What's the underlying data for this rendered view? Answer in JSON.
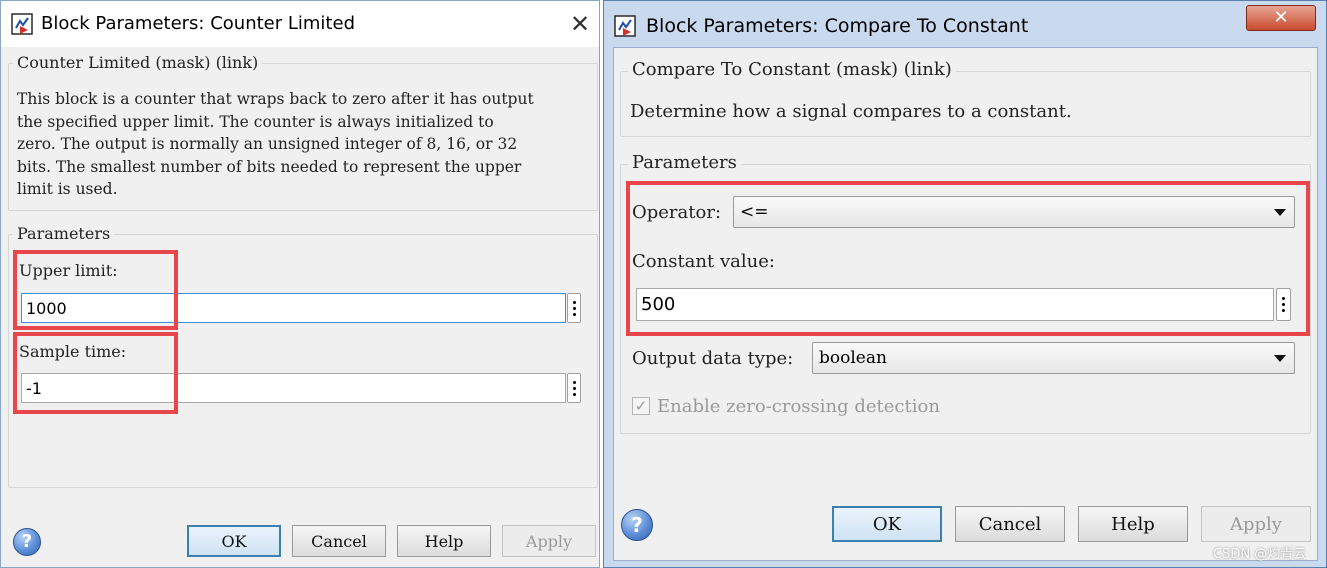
{
  "left_dialog": {
    "title": "Block Parameters: Counter Limited",
    "close_label": "✕",
    "description_group": {
      "legend": "Counter Limited (mask) (link)",
      "lines": [
        "This block is a counter that wraps back to zero after it has output",
        "the specified upper limit. The counter is always initialized to",
        "zero. The output is normally an unsigned integer of 8, 16, or 32",
        "bits. The smallest number of bits needed to represent the upper",
        "limit is used."
      ]
    },
    "parameters_group": {
      "legend": "Parameters",
      "upper_limit": {
        "label": "Upper limit:",
        "value": "1000"
      },
      "sample_time": {
        "label": "Sample time:",
        "value": "-1"
      }
    },
    "buttons": {
      "ok": "OK",
      "cancel": "Cancel",
      "help": "Help",
      "apply": "Apply"
    },
    "help_icon_text": "?"
  },
  "right_dialog": {
    "title": "Block Parameters: Compare To Constant",
    "close_label": "✕",
    "description_group": {
      "legend": "Compare To Constant (mask) (link)",
      "text": "Determine how a signal compares to a constant."
    },
    "parameters_group": {
      "legend": "Parameters",
      "operator": {
        "label": "Operator:",
        "value": "<="
      },
      "constant_value": {
        "label": "Constant value:",
        "value": "500"
      },
      "output_data_type": {
        "label": "Output data type:",
        "value": "boolean"
      },
      "zero_crossing": {
        "label": "Enable zero-crossing detection",
        "checked": true,
        "check_glyph": "✓",
        "enabled": false
      }
    },
    "buttons": {
      "ok": "OK",
      "cancel": "Cancel",
      "help": "Help",
      "apply": "Apply"
    },
    "help_icon_text": "?"
  },
  "watermark": "CSDN @灼青云",
  "colors": {
    "highlight_box": "#e8464b",
    "default_button_border": "#3c7fb1"
  }
}
